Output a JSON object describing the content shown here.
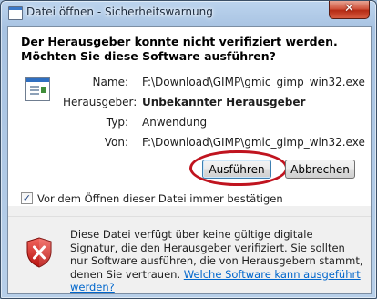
{
  "window": {
    "title": "Datei öffnen - Sicherheitswarnung",
    "close_glyph": "✕"
  },
  "dialog": {
    "heading": "Der Herausgeber konnte nicht verifiziert werden. Möchten Sie diese Software ausführen?",
    "details": [
      {
        "label": "Name:",
        "value": "F:\\Download\\GIMP\\gmic_gimp_win32.exe",
        "bold": false
      },
      {
        "label": "Herausgeber:",
        "value": "Unbekannter Herausgeber",
        "bold": true
      },
      {
        "label": "Typ:",
        "value": "Anwendung",
        "bold": false
      },
      {
        "label": "Von:",
        "value": "F:\\Download\\GIMP\\gmic_gimp_win32.exe",
        "bold": false
      }
    ],
    "buttons": {
      "run": "Ausführen",
      "cancel": "Abbrechen"
    },
    "checkbox": {
      "label": "Vor dem Öffnen dieser Datei immer bestätigen",
      "checked": true,
      "glyph": "✓"
    },
    "warning": {
      "text": "Diese Datei verfügt über keine gültige digitale Signatur, die den Herausgeber verifiziert. Sie sollten nur Software ausführen, die von Herausgebern stammt, denen Sie vertrauen.",
      "link": "Welche Software kann ausgeführt werden?",
      "icon": "security-shield-error-icon"
    }
  },
  "colors": {
    "highlight_ring": "#c0141f",
    "link": "#0066cc",
    "shield_red": "#d0231e"
  }
}
